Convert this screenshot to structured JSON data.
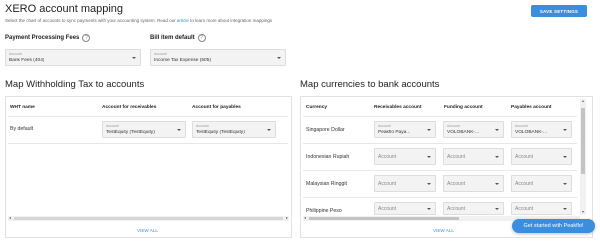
{
  "page": {
    "title": "XERO account mapping",
    "subtitle_before": "Select the chart of accounts to sync payments with your accounting system. Read our ",
    "subtitle_link": "article",
    "subtitle_after": " to learn more about integration mappings",
    "save_label": "SAVE SETTINGS"
  },
  "fees": {
    "label": "Payment Processing Fees",
    "field_label": "Account",
    "value": "Bank Fees (404)"
  },
  "bill_item": {
    "label": "Bill item default",
    "field_label": "Account",
    "value": "Income Tax Expense (505)"
  },
  "withholding": {
    "title": "Map Withholding Tax to accounts",
    "headers": [
      "WHT name",
      "Account for receivables",
      "Account for payables"
    ],
    "rows": [
      {
        "name": "By default",
        "receivables": {
          "label": "Account",
          "value": "TestEquity (TestEquity)"
        },
        "payables": {
          "label": "Account",
          "value": "TestEquity (TestEquity)"
        }
      }
    ],
    "view_all": "VIEW ALL"
  },
  "currencies": {
    "title": "Map currencies to bank accounts",
    "headers": [
      "Currency",
      "Receivables account",
      "Funding account",
      "Payables account"
    ],
    "rows": [
      {
        "currency": "Singapore Dollar",
        "receivables": {
          "label": "Account",
          "value": "Peakflo Paya..."
        },
        "funding": {
          "label": "Account",
          "value": "VOLOBANK-..."
        },
        "payables": {
          "label": "Account",
          "value": "VOLOBANK-..."
        }
      },
      {
        "currency": "Indonesian Rupiah",
        "receivables": {
          "value": "Account"
        },
        "funding": {
          "value": "Account"
        },
        "payables": {
          "value": "Account"
        }
      },
      {
        "currency": "Malaysian Ringgit",
        "receivables": {
          "value": "Account"
        },
        "funding": {
          "value": "Account"
        },
        "payables": {
          "value": "Account"
        }
      },
      {
        "currency": "Philippine Peso",
        "receivables": {
          "value": "Account"
        },
        "funding": {
          "value": "Account"
        },
        "payables": {
          "value": "Account"
        }
      }
    ],
    "view_all": "VIEW ALL"
  },
  "chat": {
    "label": "Get started with Peakflo!"
  }
}
